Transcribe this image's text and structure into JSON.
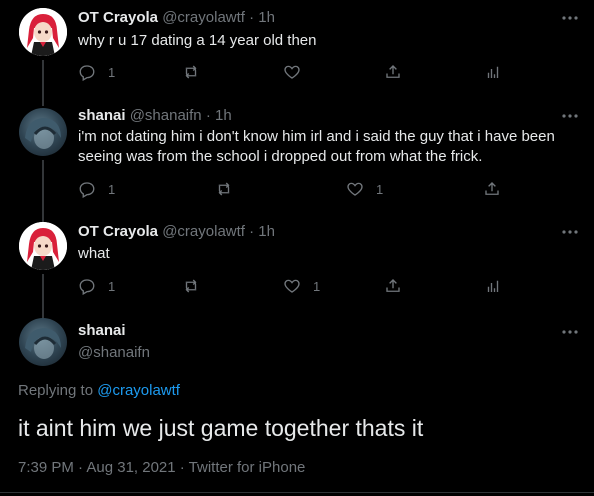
{
  "tweets": [
    {
      "name": "OT Crayola",
      "handle": "@crayolawtf",
      "separator": "·",
      "time": "1h",
      "text": "why r u 17 dating a 14 year old then",
      "reply_count": "1",
      "retweet_count": "",
      "like_count": "",
      "avatar_icon": "anime-girl-avatar"
    },
    {
      "name": "shanai",
      "handle": "@shanaifn",
      "separator": "·",
      "time": "1h",
      "text": "i'm not dating him i don't know him irl and i said the guy that i have been seeing was from the school i dropped out from what the frick.",
      "reply_count": "1",
      "retweet_count": "",
      "like_count": "1",
      "avatar_icon": "anime-avatar"
    },
    {
      "name": "OT Crayola",
      "handle": "@crayolawtf",
      "separator": "·",
      "time": "1h",
      "text": "what",
      "reply_count": "1",
      "retweet_count": "",
      "like_count": "1",
      "avatar_icon": "anime-girl-avatar"
    }
  ],
  "main_tweet": {
    "name": "shanai",
    "handle": "@shanaifn",
    "replying_label": "Replying to",
    "replying_to": "@crayolawtf",
    "text": "it aint him we just game together thats it",
    "timestamp": "7:39 PM · Aug 31, 2021 · Twitter for iPhone"
  },
  "colors": {
    "background": "#000000",
    "text": "#e7e9ea",
    "muted": "#71767b",
    "accent": "#1d9bf0"
  }
}
